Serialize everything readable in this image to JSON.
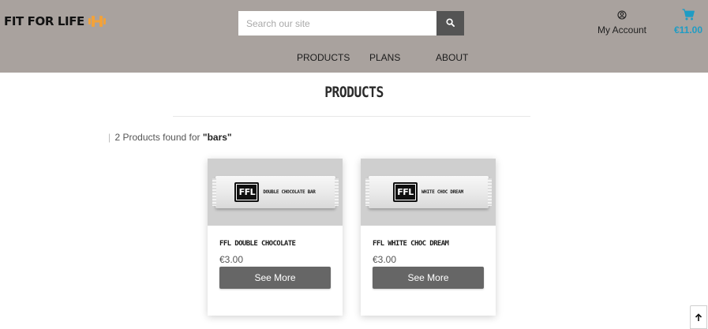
{
  "header": {
    "brand": "FIT FOR LIFE",
    "search": {
      "placeholder": "Search our site",
      "value": ""
    },
    "account_label": "My Account",
    "cart_total": "€11.00",
    "nav": [
      "PRODUCTS",
      "PLANS",
      "ABOUT"
    ]
  },
  "main": {
    "title": "PRODUCTS",
    "results_divider": "|",
    "results_count_text": "2 Products found for",
    "results_query": "\"bars\""
  },
  "products": [
    {
      "name": "FFL DOUBLE CHOCOLATE",
      "price": "€3.00",
      "button_label": "See More",
      "image": {
        "logo_text": "FFL",
        "label": "DOUBLE CHOCOLATE BAR"
      }
    },
    {
      "name": "FFL WHITE CHOC DREAM",
      "price": "€3.00",
      "button_label": "See More",
      "image": {
        "logo_text": "FFL",
        "label": "WHITE CHOC DREAM"
      }
    }
  ],
  "colors": {
    "header_bg": "#a9a29e",
    "accent_cart": "#1f9cc4",
    "brand_icon": "#f2a23a",
    "button_bg": "#666666"
  },
  "icons": {
    "brand": "dumbbell-icon",
    "search": "search-icon",
    "account": "user-circle-icon",
    "cart": "cart-icon",
    "back_to_top": "arrow-up-icon"
  }
}
